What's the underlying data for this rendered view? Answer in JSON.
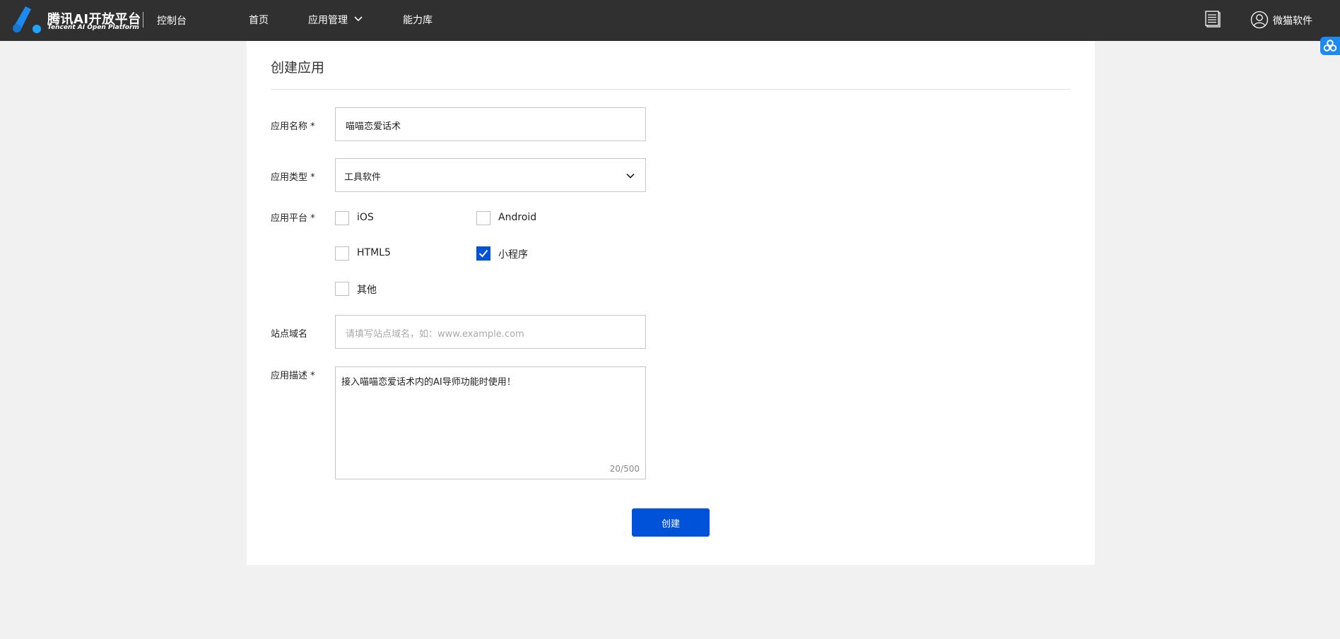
{
  "header": {
    "logo_title": "腾讯AI开放平台",
    "logo_subtitle": "Tencent AI Open Platform",
    "console_label": "控制台",
    "nav": {
      "home": "首页",
      "app_management": "应用管理",
      "capability_library": "能力库"
    },
    "user_name": "微猫软件",
    "icons": {
      "docs": "document-list-icon",
      "user": "user-avatar-icon",
      "chevron": "chevron-down-icon",
      "float": "cloud-link-icon"
    }
  },
  "form": {
    "title": "创建应用",
    "app_name": {
      "label": "应用名称 *",
      "value": "喵喵恋爱话术"
    },
    "app_type": {
      "label": "应用类型 *",
      "selected": "工具软件"
    },
    "platform": {
      "label": "应用平台 *",
      "options": [
        {
          "label": "iOS",
          "checked": false
        },
        {
          "label": "Android",
          "checked": false
        },
        {
          "label": "HTML5",
          "checked": false
        },
        {
          "label": "小程序",
          "checked": true
        },
        {
          "label": "其他",
          "checked": false
        }
      ]
    },
    "site_domain": {
      "label": "站点域名",
      "value": "",
      "placeholder": "请填写站点域名，如：www.example.com"
    },
    "description": {
      "label": "应用描述 *",
      "value": "接入喵喵恋爱话术内的AI导师功能时使用！",
      "counter": "20/500"
    },
    "submit_label": "创建"
  },
  "colors": {
    "topbar": "#303030",
    "primary": "#0052d9",
    "page_background": "#f1f1f1",
    "logo_accent": "#1c8af0"
  }
}
